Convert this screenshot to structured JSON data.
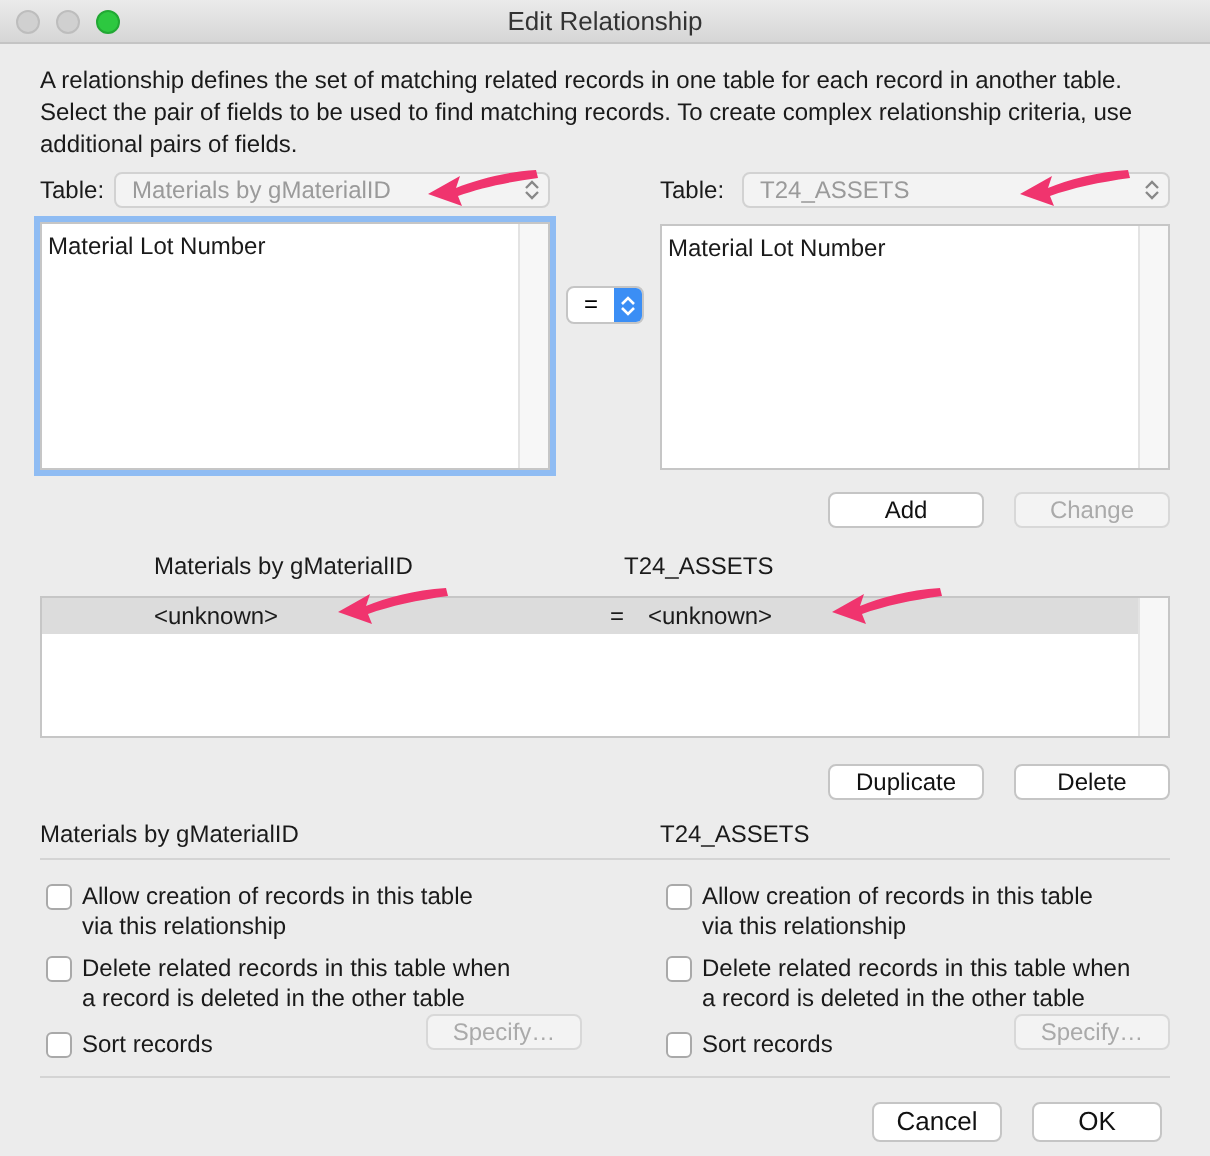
{
  "window": {
    "title": "Edit Relationship"
  },
  "description": "A relationship defines the set of matching related records in one table for each record in another table. Select the pair of fields to be used to find matching records. To create complex relationship criteria, use additional pairs of fields.",
  "tables": [
    {
      "label": "Table:",
      "value": "Materials by gMaterialID",
      "disabled": true,
      "arrow": true,
      "focused": true,
      "fields": [
        "Material Lot Number"
      ]
    },
    {
      "label": "Table:",
      "value": "T24_ASSETS",
      "disabled": true,
      "arrow": true,
      "focused": false,
      "fields": [
        "Material Lot Number"
      ]
    }
  ],
  "operator": "=",
  "field_buttons": [
    {
      "label": "Add",
      "disabled": false
    },
    {
      "label": "Change",
      "disabled": true
    }
  ],
  "criteria": {
    "columns": [
      "Materials by gMaterialID",
      "T24_ASSETS"
    ],
    "rows": [
      {
        "left": "<unknown>",
        "operator": "=",
        "right": "<unknown>",
        "selected": true,
        "arrow": true
      }
    ]
  },
  "criteria_buttons": [
    {
      "label": "Duplicate",
      "disabled": false
    },
    {
      "label": "Delete",
      "disabled": false
    }
  ],
  "sides": [
    {
      "title": "Materials by gMaterialID",
      "options": [
        {
          "kind": "checkbox",
          "label": "Allow creation of records in this table\nvia this relationship",
          "checked": false
        },
        {
          "kind": "checkbox",
          "label": "Delete related records in this table when\na record is deleted in the other table",
          "checked": false
        },
        {
          "kind": "checkbox_button",
          "label": "Sort records",
          "checked": false,
          "button": {
            "label": "Specify…",
            "disabled": true
          }
        }
      ]
    },
    {
      "title": "T24_ASSETS",
      "options": [
        {
          "kind": "checkbox",
          "label": "Allow creation of records in this table\nvia this relationship",
          "checked": false
        },
        {
          "kind": "checkbox",
          "label": "Delete related records in this table when\na record is deleted in the other table",
          "checked": false
        },
        {
          "kind": "checkbox_button",
          "label": "Sort records",
          "checked": false,
          "button": {
            "label": "Specify…",
            "disabled": true
          }
        }
      ]
    }
  ],
  "footer_buttons": [
    {
      "label": "Cancel",
      "disabled": false
    },
    {
      "label": "OK",
      "disabled": false
    }
  ]
}
